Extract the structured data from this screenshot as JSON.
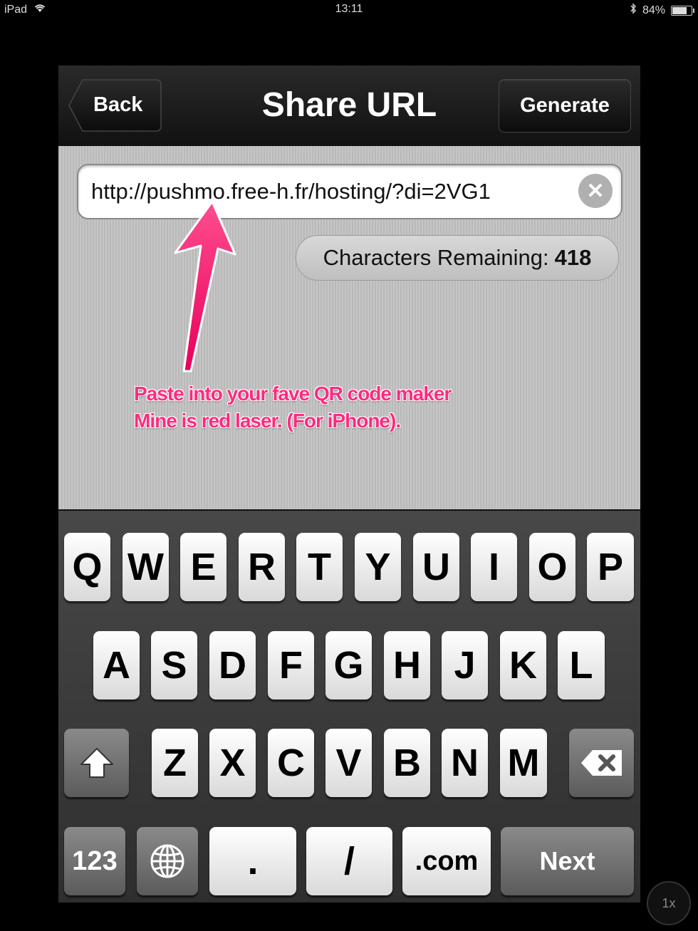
{
  "status_bar": {
    "device": "iPad",
    "time": "13:11",
    "battery": "84%",
    "battery_level": 0.84
  },
  "nav": {
    "back_label": "Back",
    "title": "Share URL",
    "generate_label": "Generate"
  },
  "url_field": {
    "value": "http://pushmo.free-h.fr/hosting/?di=2VG1"
  },
  "chars_remaining": {
    "label": "Characters Remaining:",
    "count": "418"
  },
  "annotation": {
    "line1": "Paste into your fave QR code maker",
    "line2": "Mine is red laser. (For iPhone)."
  },
  "keyboard": {
    "row1": [
      "Q",
      "W",
      "E",
      "R",
      "T",
      "Y",
      "U",
      "I",
      "O",
      "P"
    ],
    "row2": [
      "A",
      "S",
      "D",
      "F",
      "G",
      "H",
      "J",
      "K",
      "L"
    ],
    "row3": [
      "Z",
      "X",
      "C",
      "V",
      "B",
      "N",
      "M"
    ],
    "numbers_label": "123",
    "dot_label": ".",
    "slash_label": "/",
    "dotcom_label": ".com",
    "next_label": "Next"
  },
  "zoom_label": "1x",
  "colors": {
    "annotation": "#ff2a7f",
    "navbar": "#111111"
  }
}
